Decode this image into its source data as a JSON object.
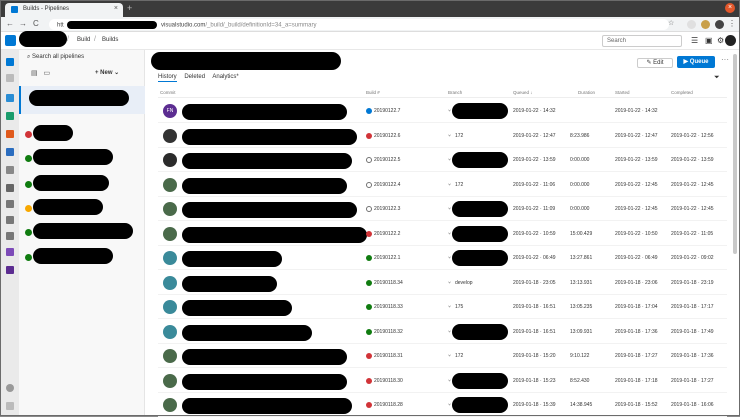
{
  "browser": {
    "tab_title": "Builds - Pipelines",
    "tab_close": "×",
    "new_tab": "+",
    "url_prefix": "htt",
    "url_host_suffix": "visualstudio.com",
    "url_path": "/_build/_build/definitionId=34_a=summary",
    "back": "←",
    "forward": "→",
    "reload": "C",
    "star": "☆"
  },
  "header": {
    "crumb_build": "Build",
    "crumb_builds": "Builds",
    "separator": "/",
    "search_placeholder": "Search"
  },
  "pipelines": {
    "search_label": "Search all pipelines",
    "new_label": "New",
    "status_colors": [
      "#d13438",
      "#107c10",
      "#107c10",
      "#f8a800",
      "#107c10",
      "#107c10"
    ]
  },
  "toolbar": {
    "edit_label": "Edit",
    "queue_label": "Queue",
    "more": "···"
  },
  "tabs": [
    "History",
    "Deleted",
    "Analytics*"
  ],
  "columns": {
    "commit": "Commit",
    "build": "Build #",
    "branch": "Branch",
    "queued": "Queued ↓",
    "duration": "Duration",
    "started": "Started",
    "completed": "Completed"
  },
  "colors": {
    "accent": "#0078d4",
    "failed": "#d13438",
    "succeeded": "#107c10",
    "canceled": "#707070"
  },
  "rows": [
    {
      "avatar": "FN",
      "avatar_color": "#5c2d91",
      "status": "running",
      "build": "20190122.7",
      "branch": "",
      "queued": "2019-01-22 · 14:32",
      "duration": "",
      "started": "2019-01-22 · 14:32",
      "completed": ""
    },
    {
      "avatar": "",
      "avatar_color": "#333333",
      "status": "failed",
      "build": "20190122.6",
      "branch": "172",
      "queued": "2019-01-22 · 12:47",
      "duration": "8:23.986",
      "started": "2019-01-22 · 12:47",
      "completed": "2019-01-22 · 12:56"
    },
    {
      "avatar": "",
      "avatar_color": "#2b2b2b",
      "status": "canceled",
      "build": "20190122.5",
      "branch": "",
      "queued": "2019-01-22 · 13:59",
      "duration": "0:00.000",
      "started": "2019-01-22 · 13:59",
      "completed": "2019-01-22 · 13:59"
    },
    {
      "avatar": "",
      "avatar_color": "#4a6a4a",
      "status": "canceled",
      "build": "20190122.4",
      "branch": "172",
      "queued": "2019-01-22 · 11:06",
      "duration": "0:00.000",
      "started": "2019-01-22 · 12:45",
      "completed": "2019-01-22 · 12:45"
    },
    {
      "avatar": "",
      "avatar_color": "#4a6a4a",
      "status": "canceled",
      "build": "20190122.3",
      "branch": "",
      "queued": "2019-01-22 · 11:09",
      "duration": "0:00.000",
      "started": "2019-01-22 · 12:45",
      "completed": "2019-01-22 · 12:45"
    },
    {
      "avatar": "",
      "avatar_color": "#4a6a4a",
      "status": "failed",
      "build": "20190122.2",
      "branch": "",
      "queued": "2019-01-22 · 10:59",
      "duration": "15:00.429",
      "started": "2019-01-22 · 10:50",
      "completed": "2019-01-22 · 11:05"
    },
    {
      "avatar": "",
      "avatar_color": "#3a8a9a",
      "status": "succeeded",
      "build": "20190122.1",
      "branch": "",
      "queued": "2019-01-22 · 06:49",
      "duration": "13:27.861",
      "started": "2019-01-22 · 06:49",
      "completed": "2019-01-22 · 09:02"
    },
    {
      "avatar": "",
      "avatar_color": "#3a8a9a",
      "status": "succeeded",
      "build": "20190118.34",
      "branch": "develop",
      "queued": "2019-01-18 · 23:05",
      "duration": "13:13.931",
      "started": "2019-01-18 · 23:06",
      "completed": "2019-01-18 · 23:19"
    },
    {
      "avatar": "",
      "avatar_color": "#3a8a9a",
      "status": "succeeded",
      "build": "20190118.33",
      "branch": "175",
      "queued": "2019-01-18 · 16:51",
      "duration": "13:05.235",
      "started": "2019-01-18 · 17:04",
      "completed": "2019-01-18 · 17:17"
    },
    {
      "avatar": "",
      "avatar_color": "#3a8a9a",
      "status": "succeeded",
      "build": "20190118.32",
      "branch": "",
      "queued": "2019-01-18 · 16:51",
      "duration": "13:09.931",
      "started": "2019-01-18 · 17:36",
      "completed": "2019-01-18 · 17:49"
    },
    {
      "avatar": "",
      "avatar_color": "#4a6a4a",
      "status": "failed",
      "build": "20190118.31",
      "branch": "172",
      "queued": "2019-01-18 · 15:20",
      "duration": "9:10.122",
      "started": "2019-01-18 · 17:27",
      "completed": "2019-01-18 · 17:36"
    },
    {
      "avatar": "",
      "avatar_color": "#4a6a4a",
      "status": "failed",
      "build": "20190118.30",
      "branch": "",
      "queued": "2019-01-18 · 15:23",
      "duration": "8:52.430",
      "started": "2019-01-18 · 17:18",
      "completed": "2019-01-18 · 17:27"
    },
    {
      "avatar": "",
      "avatar_color": "#4a6a4a",
      "status": "failed",
      "build": "20190118.28",
      "branch": "",
      "queued": "2019-01-18 · 15:39",
      "duration": "14:38.945",
      "started": "2019-01-18 · 15:52",
      "completed": "2019-01-18 · 16:06"
    }
  ]
}
